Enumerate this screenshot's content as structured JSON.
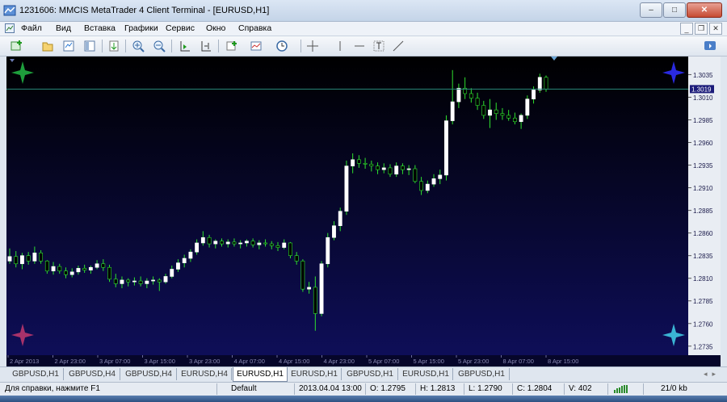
{
  "window": {
    "title": "1231606: MMCIS MetaTrader 4 Client Terminal - [EURUSD,H1]"
  },
  "menu": [
    "Файл",
    "Вид",
    "Вставка",
    "Графики",
    "Сервис",
    "Окно",
    "Справка"
  ],
  "toolbar": {
    "icons": [
      "new-chart-icon",
      "profiles-icon",
      "market-watch-icon",
      "navigator-icon",
      "new-order-icon",
      "zoom-in-icon",
      "zoom-out-icon",
      "auto-scroll-icon",
      "chart-shift-icon",
      "indicators-icon",
      "templates-icon",
      "periods-icon",
      "crosshair-icon",
      "vertical-line-icon",
      "horizontal-line-icon",
      "text-icon",
      "trendline-icon"
    ]
  },
  "chart_data": {
    "type": "candlestick",
    "symbol": "EURUSD,H1",
    "bid_label": "1.3019",
    "ylim": [
      1.2725,
      1.3055
    ],
    "yticks": [
      "1.3035",
      "1.3010",
      "1.2985",
      "1.2960",
      "1.2935",
      "1.2910",
      "1.2885",
      "1.2860",
      "1.2835",
      "1.2810",
      "1.2785",
      "1.2760",
      "1.2735"
    ],
    "xticks": [
      "2 Apr 2013",
      "2 Apr 23:00",
      "3 Apr 07:00",
      "3 Apr 15:00",
      "3 Apr 23:00",
      "4 Apr 07:00",
      "4 Apr 15:00",
      "4 Apr 23:00",
      "5 Apr 07:00",
      "5 Apr 15:00",
      "5 Apr 23:00",
      "8 Apr 07:00",
      "8 Apr 15:00"
    ],
    "colors": {
      "background_top": "#000000",
      "background_bottom": "#0e0e58",
      "bull": "#ffffff",
      "bear": "#000000",
      "wick": "#2ee02e",
      "bid_line": "#2a8a7a"
    },
    "candles": [
      [
        1.2829,
        1.2843,
        1.2826,
        1.2834
      ],
      [
        1.2834,
        1.284,
        1.2822,
        1.2826
      ],
      [
        1.2826,
        1.2838,
        1.282,
        1.2835
      ],
      [
        1.2835,
        1.2839,
        1.2825,
        1.2829
      ],
      [
        1.2829,
        1.2845,
        1.2826,
        1.2838
      ],
      [
        1.2838,
        1.2841,
        1.2826,
        1.2829
      ],
      [
        1.2829,
        1.283,
        1.2815,
        1.2818
      ],
      [
        1.2818,
        1.2828,
        1.2814,
        1.2823
      ],
      [
        1.2823,
        1.2826,
        1.2815,
        1.2818
      ],
      [
        1.2818,
        1.2822,
        1.281,
        1.2814
      ],
      [
        1.2814,
        1.2821,
        1.2811,
        1.2817
      ],
      [
        1.2817,
        1.2824,
        1.2814,
        1.2821
      ],
      [
        1.2821,
        1.2825,
        1.2816,
        1.2819
      ],
      [
        1.2819,
        1.2824,
        1.2815,
        1.2822
      ],
      [
        1.2822,
        1.283,
        1.282,
        1.2826
      ],
      [
        1.2826,
        1.2831,
        1.2818,
        1.2822
      ],
      [
        1.2822,
        1.2825,
        1.2806,
        1.2809
      ],
      [
        1.2809,
        1.2815,
        1.28,
        1.2804
      ],
      [
        1.2804,
        1.2812,
        1.2799,
        1.2808
      ],
      [
        1.2808,
        1.281,
        1.2801,
        1.2806
      ],
      [
        1.2806,
        1.2811,
        1.2802,
        1.2807
      ],
      [
        1.2807,
        1.2812,
        1.2801,
        1.2804
      ],
      [
        1.2804,
        1.281,
        1.2799,
        1.2807
      ],
      [
        1.2807,
        1.2812,
        1.2803,
        1.2808
      ],
      [
        1.2808,
        1.281,
        1.2796,
        1.2806
      ],
      [
        1.2806,
        1.2815,
        1.2804,
        1.2812
      ],
      [
        1.2812,
        1.2824,
        1.281,
        1.282
      ],
      [
        1.282,
        1.2831,
        1.2817,
        1.2827
      ],
      [
        1.2827,
        1.2836,
        1.2822,
        1.2832
      ],
      [
        1.2832,
        1.2842,
        1.2828,
        1.2839
      ],
      [
        1.2839,
        1.2853,
        1.2836,
        1.2849
      ],
      [
        1.2849,
        1.2862,
        1.2846,
        1.2855
      ],
      [
        1.2855,
        1.2858,
        1.2844,
        1.2848
      ],
      [
        1.2848,
        1.2853,
        1.2843,
        1.2851
      ],
      [
        1.2851,
        1.2854,
        1.2845,
        1.2848
      ],
      [
        1.2848,
        1.2853,
        1.2844,
        1.285
      ],
      [
        1.285,
        1.2854,
        1.2845,
        1.2848
      ],
      [
        1.2848,
        1.2852,
        1.2843,
        1.2849
      ],
      [
        1.2849,
        1.2853,
        1.2845,
        1.2851
      ],
      [
        1.2851,
        1.2854,
        1.2844,
        1.2847
      ],
      [
        1.2847,
        1.2852,
        1.2842,
        1.2849
      ],
      [
        1.2849,
        1.2853,
        1.2845,
        1.2848
      ],
      [
        1.2848,
        1.2851,
        1.2842,
        1.2846
      ],
      [
        1.2846,
        1.285,
        1.284,
        1.2844
      ],
      [
        1.2844,
        1.2853,
        1.2842,
        1.2849
      ],
      [
        1.2849,
        1.285,
        1.2832,
        1.2835
      ],
      [
        1.2835,
        1.2839,
        1.2825,
        1.2829
      ],
      [
        1.2829,
        1.2831,
        1.2795,
        1.2798
      ],
      [
        1.2798,
        1.2806,
        1.2793,
        1.28
      ],
      [
        1.28,
        1.2812,
        1.2752,
        1.2771
      ],
      [
        1.2771,
        1.2829,
        1.2768,
        1.2826
      ],
      [
        1.2826,
        1.286,
        1.2822,
        1.2855
      ],
      [
        1.2855,
        1.2873,
        1.2852,
        1.2868
      ],
      [
        1.2868,
        1.2888,
        1.2862,
        1.2884
      ],
      [
        1.2884,
        1.294,
        1.288,
        1.2934
      ],
      [
        1.2934,
        1.2948,
        1.2926,
        1.2941
      ],
      [
        1.2941,
        1.2946,
        1.2932,
        1.2937
      ],
      [
        1.2937,
        1.2943,
        1.2931,
        1.2936
      ],
      [
        1.2936,
        1.294,
        1.2928,
        1.2934
      ],
      [
        1.2934,
        1.2938,
        1.2925,
        1.293
      ],
      [
        1.293,
        1.2937,
        1.2926,
        1.2932
      ],
      [
        1.2932,
        1.2936,
        1.2922,
        1.2925
      ],
      [
        1.2925,
        1.2938,
        1.2922,
        1.2934
      ],
      [
        1.2934,
        1.2937,
        1.2925,
        1.293
      ],
      [
        1.293,
        1.2935,
        1.2924,
        1.2931
      ],
      [
        1.2931,
        1.2935,
        1.2915,
        1.2917
      ],
      [
        1.2917,
        1.2922,
        1.2902,
        1.2907
      ],
      [
        1.2907,
        1.2918,
        1.2904,
        1.2914
      ],
      [
        1.2914,
        1.2925,
        1.2911,
        1.292
      ],
      [
        1.292,
        1.293,
        1.2914,
        1.2924
      ],
      [
        1.2924,
        1.299,
        1.2918,
        1.2984
      ],
      [
        1.2984,
        1.304,
        1.298,
        1.3005
      ],
      [
        1.3005,
        1.3025,
        1.2998,
        1.302
      ],
      [
        1.302,
        1.3032,
        1.3008,
        1.3014
      ],
      [
        1.3014,
        1.302,
        1.3004,
        1.3009
      ],
      [
        1.3009,
        1.3015,
        1.2996,
        1.3001
      ],
      [
        1.3001,
        1.3006,
        1.2986,
        1.299
      ],
      [
        1.299,
        1.3008,
        1.2976,
        1.2996
      ],
      [
        1.2996,
        1.3004,
        1.2985,
        1.2992
      ],
      [
        1.2992,
        1.2998,
        1.2985,
        1.299
      ],
      [
        1.299,
        1.2996,
        1.2984,
        1.2987
      ],
      [
        1.2987,
        1.2993,
        1.298,
        1.2983
      ],
      [
        1.2983,
        1.2992,
        1.2975,
        1.299
      ],
      [
        1.299,
        1.3012,
        1.2986,
        1.3008
      ],
      [
        1.3008,
        1.3022,
        1.3003,
        1.3018
      ],
      [
        1.3018,
        1.3036,
        1.3015,
        1.3032
      ],
      [
        1.3032,
        1.3034,
        1.3016,
        1.3019
      ]
    ]
  },
  "tabs": [
    "GBPUSD,H1",
    "GBPUSD,H4",
    "GBPUSD,H4",
    "EURUSD,H4",
    "EURUSD,H1",
    "EURUSD,H1",
    "GBPUSD,H1",
    "EURUSD,H1",
    "GBPUSD,H1"
  ],
  "active_tab": 4,
  "status": {
    "help": "Для справки, нажмите F1",
    "profile": "Default",
    "datetime": "2013.04.04 13:00",
    "open": "O: 1.2795",
    "high": "H: 1.2813",
    "low": "L: 1.2790",
    "close": "C: 1.2804",
    "volume": "V: 402",
    "traffic": "21/0 kb"
  }
}
